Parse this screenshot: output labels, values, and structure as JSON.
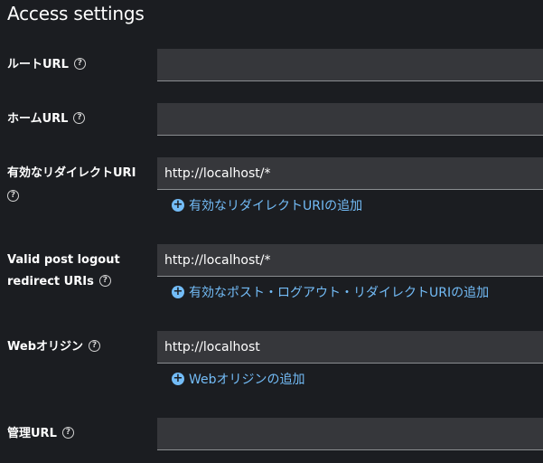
{
  "section": {
    "title": "Access settings"
  },
  "fields": {
    "root_url": {
      "label": "ルートURL",
      "value": ""
    },
    "home_url": {
      "label": "ホームURL",
      "value": ""
    },
    "redirect_uri": {
      "label": "有効なリダイレクトURI",
      "value": "http://localhost/*",
      "add_label": "有効なリダイレクトURIの追加"
    },
    "post_logout": {
      "label_line1": "Valid post logout",
      "label_line2": "redirect URIs",
      "value": "http://localhost/*",
      "add_label": "有効なポスト・ログアウト・リダイレクトURIの追加"
    },
    "web_origins": {
      "label": "Webオリジン",
      "value": "http://localhost",
      "add_label": "Webオリジンの追加"
    },
    "admin_url": {
      "label": "管理URL",
      "value": ""
    }
  },
  "icons": {
    "help": "?",
    "add": "+"
  },
  "colors": {
    "background": "#1b1d21",
    "field_bg": "#36373b",
    "link": "#73bcf7"
  }
}
